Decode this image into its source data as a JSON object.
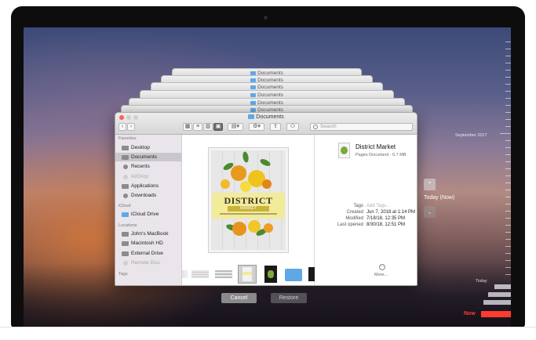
{
  "window": {
    "title": "Documents",
    "stack_titles": [
      "Documents",
      "Documents",
      "Documents",
      "Documents"
    ]
  },
  "toolbar": {
    "back_icon": "chevron-left-icon",
    "forward_icon": "chevron-right-icon",
    "search_placeholder": "Search"
  },
  "sidebar": {
    "favorites_header": "Favorites",
    "favorites": [
      {
        "label": "Desktop",
        "icon": "desktop-icon"
      },
      {
        "label": "Documents",
        "icon": "documents-icon",
        "selected": true
      },
      {
        "label": "Recents",
        "icon": "clock-icon"
      },
      {
        "label": "AirDrop",
        "icon": "airdrop-icon",
        "dimmed": true
      },
      {
        "label": "Applications",
        "icon": "applications-icon"
      },
      {
        "label": "Downloads",
        "icon": "downloads-icon"
      }
    ],
    "icloud_header": "iCloud",
    "icloud": [
      {
        "label": "iCloud Drive",
        "icon": "cloud-icon"
      }
    ],
    "locations_header": "Locations",
    "locations": [
      {
        "label": "John's MacBook",
        "icon": "laptop-icon"
      },
      {
        "label": "Macintosh HD",
        "icon": "disk-icon"
      },
      {
        "label": "External Drive",
        "icon": "external-drive-icon"
      },
      {
        "label": "Remote Disc",
        "icon": "remote-disc-icon",
        "dimmed": true
      }
    ],
    "tags_header": "Tags"
  },
  "preview": {
    "poster_title": "DISTRICT",
    "poster_subtitle": "MARKET"
  },
  "info": {
    "name": "District Market",
    "kind": "Pages Document - 6.7 MB",
    "rows": [
      {
        "key": "Tags",
        "value": "Add Tags...",
        "placeholder": true
      },
      {
        "key": "Created",
        "value": "Jun 7, 2018 at 1:14 PM"
      },
      {
        "key": "Modified",
        "value": "7/18/18, 12:35 PM"
      },
      {
        "key": "Last opened",
        "value": "8/30/18, 12:51 PM"
      }
    ],
    "more_label": "More..."
  },
  "actions": {
    "cancel": "Cancel",
    "restore": "Restore"
  },
  "time_machine": {
    "up_icon": "chevron-up-icon",
    "down_icon": "chevron-down-icon",
    "current": "Today (Now)",
    "label_september": "September 2017",
    "label_today": "Today",
    "label_now": "Now",
    "now_color": "#ff3b30"
  }
}
